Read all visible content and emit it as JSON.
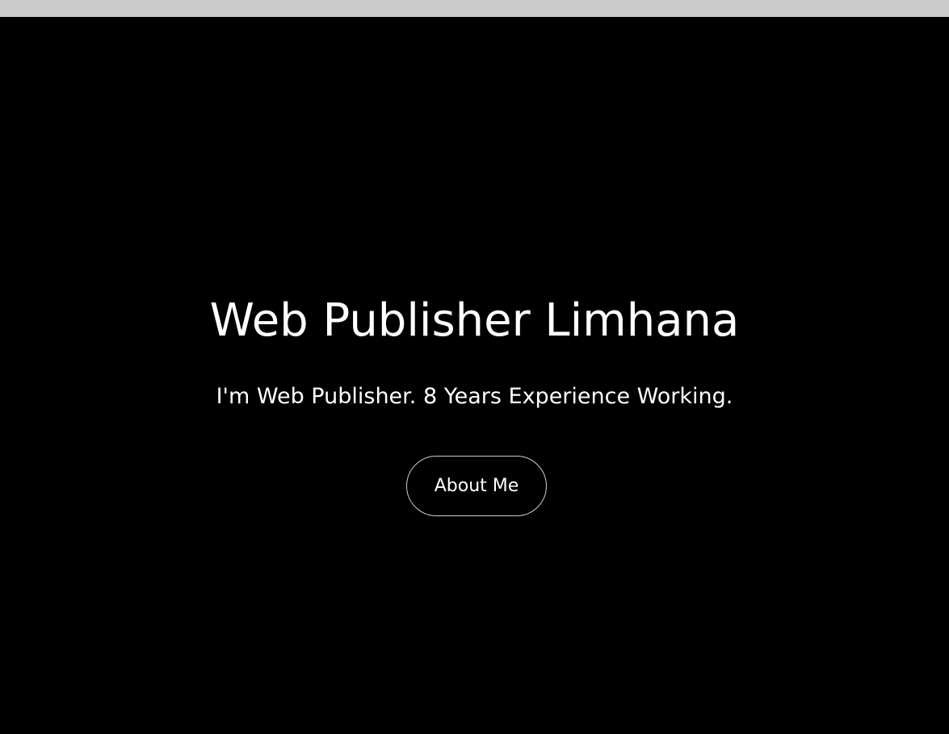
{
  "hero": {
    "title": "Web Publisher Limhana",
    "subtitle": "I'm Web Publisher. 8 Years Experience Working.",
    "button_label": "About Me"
  },
  "colors": {
    "background": "#000000",
    "top_bar": "#cbcbcb",
    "text": "#ffffff",
    "button_border": "#cfcfcf"
  }
}
